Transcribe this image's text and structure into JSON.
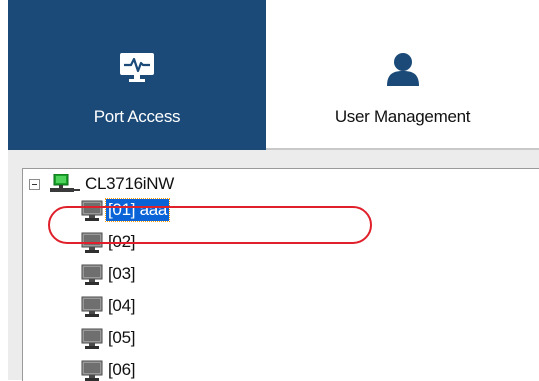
{
  "nav": {
    "tabs": [
      {
        "label": "Port Access",
        "icon": "monitor-pulse-icon",
        "active": true
      },
      {
        "label": "User Management",
        "icon": "user-icon",
        "active": false
      }
    ]
  },
  "tree": {
    "root": {
      "label": "CL3716iNW",
      "icon": "network-computer-icon",
      "expanded": true
    },
    "ports": [
      {
        "label": "[01] aaa",
        "selected": true
      },
      {
        "label": "[02]",
        "selected": false
      },
      {
        "label": "[03]",
        "selected": false
      },
      {
        "label": "[04]",
        "selected": false
      },
      {
        "label": "[05]",
        "selected": false
      },
      {
        "label": "[06]",
        "selected": false
      }
    ]
  },
  "colors": {
    "active_tab": "#1b4a78",
    "selection": "#0a64d8",
    "callout": "#e0202a"
  }
}
